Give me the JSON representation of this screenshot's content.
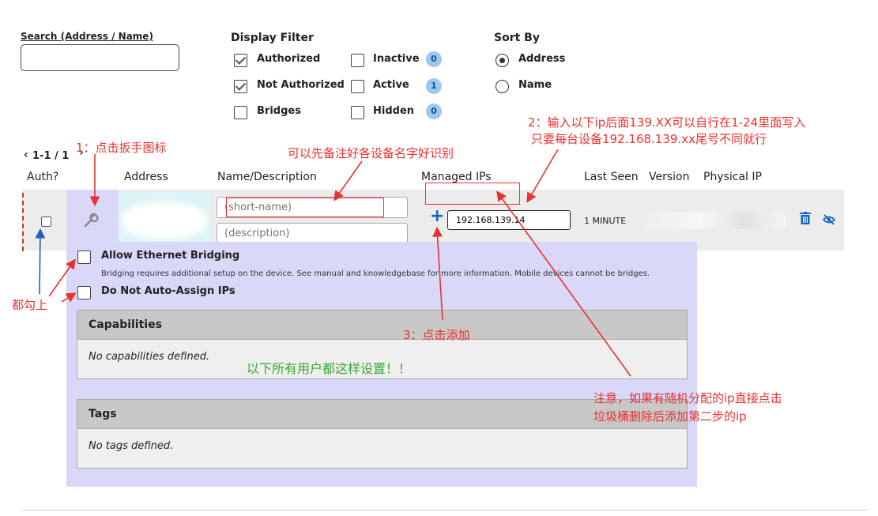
{
  "search": {
    "label": "Search (Address / Name)",
    "value": ""
  },
  "filter": {
    "title": "Display Filter",
    "options": [
      {
        "label": "Authorized",
        "checked": true
      },
      {
        "label": "Not Authorized",
        "checked": true
      },
      {
        "label": "Bridges",
        "checked": false
      },
      {
        "label": "Inactive",
        "checked": false,
        "count": "0"
      },
      {
        "label": "Active",
        "checked": false,
        "count": "1"
      },
      {
        "label": "Hidden",
        "checked": false,
        "count": "0"
      }
    ]
  },
  "sort": {
    "title": "Sort By",
    "options": [
      {
        "label": "Address",
        "selected": true
      },
      {
        "label": "Name",
        "selected": false
      }
    ]
  },
  "pagination": {
    "text": "1-1 / 1"
  },
  "columns": [
    "Auth?",
    "Address",
    "Name/Description",
    "Managed IPs",
    "Last Seen",
    "Version",
    "Physical IP"
  ],
  "member": {
    "name_placeholder": "(short-name)",
    "desc_placeholder": "(description)",
    "ip_value": "192.168.139.14",
    "last_seen": "1 MINUTE"
  },
  "details": {
    "bridging_label": "Allow Ethernet Bridging",
    "bridging_help": "Bridging requires additional setup on the device. See manual and knowledgebase for more information. Mobile devices cannot be bridges.",
    "no_auto_ip_label": "Do Not Auto-Assign IPs",
    "capabilities_title": "Capabilities",
    "capabilities_empty": "No capabilities defined.",
    "tags_title": "Tags",
    "tags_empty": "No tags defined."
  },
  "annotations": {
    "step1": "1：点击扳手图标",
    "name_note": "可以先备注好各设备名字好识别",
    "step2_line1": "2：输入以下ip后面139.XX可以自行在1-24里面写入",
    "step2_line2": "只要每台设备192.168.139.xx尾号不同就行",
    "check_all": "都勾上",
    "step3": "3：点击添加",
    "all_users": "以下所有用户都这样设置！！",
    "note_line1": "注意，如果有随机分配的ip直接点击",
    "note_line2": "垃圾桶删除后添加第二步的ip"
  },
  "colors": {
    "accent": "#1565c0",
    "annotation": "#e8322f",
    "panel": "#d9d8f8",
    "green_note": "#3aa832"
  }
}
